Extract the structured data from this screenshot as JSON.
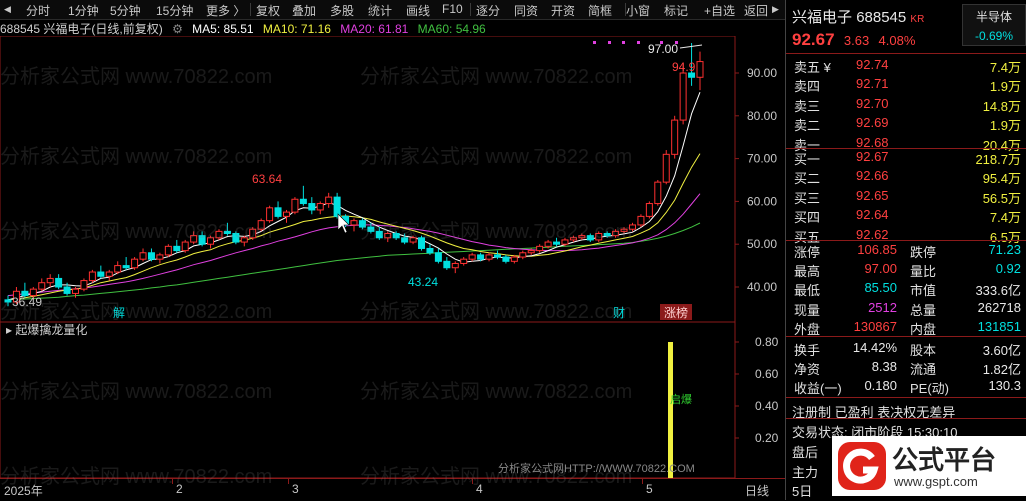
{
  "toolbar": {
    "items": [
      "分时",
      "1分钟",
      "5分钟",
      "15分钟",
      "更多 〉",
      "复权",
      "叠加",
      "多股",
      "统计",
      "画线",
      "F10",
      "逐分",
      "同资",
      "开资",
      "简框",
      "小窗",
      "标记",
      "+自选",
      "返回"
    ],
    "nav_prev": "◀",
    "nav_next": "▶"
  },
  "legend": {
    "stock": "688545 兴福电子(日线,前复权)",
    "ma5": "MA5: 85.51",
    "ma10": "MA10: 71.16",
    "ma20": "MA20: 61.81",
    "ma60": "MA60: 54.96",
    "ma_color_5": "#ffffff",
    "ma_color_10": "#f0f040",
    "ma_color_20": "#e040e0",
    "ma_color_60": "#40c040"
  },
  "main_chart": {
    "y_ticks": [
      "90.00",
      "80.00",
      "70.00",
      "60.00",
      "50.00",
      "40.00"
    ],
    "annotations": {
      "high_label": "63.64",
      "low_label": "43.24",
      "left_label": "36.49",
      "peak_label": "97.00",
      "near_peak_label": "94.9"
    },
    "markers": {
      "jie": "解",
      "cai": "财",
      "zhangbang": "涨榜"
    }
  },
  "indicator": {
    "title": "起爆擒龙量化",
    "y_ticks": [
      "0.80",
      "0.60",
      "0.40",
      "0.20"
    ],
    "signal_label": "启爆",
    "footer": "分析家公式网HTTP://WWW.70822.COM"
  },
  "x_axis": {
    "labels": [
      "2025年",
      "2",
      "3",
      "4",
      "5"
    ],
    "period": "日线"
  },
  "chart_data": {
    "type": "candlestick",
    "title": "688545 兴福电子(日线,前复权)",
    "y_range": [
      35,
      100
    ],
    "candles": [
      [
        37,
        38,
        35.5,
        36.5
      ],
      [
        36.5,
        40,
        36,
        39
      ],
      [
        39,
        41,
        37.5,
        38
      ],
      [
        38,
        40,
        37,
        39.5
      ],
      [
        39.5,
        42,
        39,
        41
      ],
      [
        41,
        43,
        40,
        42
      ],
      [
        42,
        43,
        39.5,
        40
      ],
      [
        40,
        41,
        38,
        38.5
      ],
      [
        38.5,
        40,
        37.5,
        39.5
      ],
      [
        39.5,
        42,
        39,
        41.5
      ],
      [
        41.5,
        44,
        41,
        43.5
      ],
      [
        43.5,
        45,
        42,
        42.5
      ],
      [
        42.5,
        44,
        41.5,
        43.5
      ],
      [
        43.5,
        46,
        43,
        45
      ],
      [
        45,
        47,
        44,
        44.5
      ],
      [
        44.5,
        47,
        44,
        46.5
      ],
      [
        46.5,
        49,
        46,
        48
      ],
      [
        48,
        49,
        46,
        46.5
      ],
      [
        46.5,
        48,
        45.5,
        47.5
      ],
      [
        47.5,
        50,
        47,
        49.5
      ],
      [
        49.5,
        51,
        48,
        48.5
      ],
      [
        48.5,
        51,
        48,
        50.5
      ],
      [
        50.5,
        53,
        50,
        52
      ],
      [
        52,
        53,
        49.5,
        50
      ],
      [
        50,
        52,
        49,
        51.5
      ],
      [
        51.5,
        53.5,
        51,
        53
      ],
      [
        53,
        55,
        52,
        52.5
      ],
      [
        52.5,
        53,
        50,
        50.5
      ],
      [
        50.5,
        52,
        49.5,
        51.5
      ],
      [
        51.5,
        54,
        51,
        53.5
      ],
      [
        53.5,
        56,
        53,
        55.5
      ],
      [
        55.5,
        59,
        55,
        58.5
      ],
      [
        58.5,
        60,
        56,
        56.5
      ],
      [
        56.5,
        58,
        55,
        57.5
      ],
      [
        57.5,
        61,
        57,
        60.5
      ],
      [
        60.5,
        63.64,
        59,
        59.5
      ],
      [
        59.5,
        61,
        57,
        58
      ],
      [
        58,
        60,
        57,
        59.5
      ],
      [
        59.5,
        62,
        58.5,
        61
      ],
      [
        61,
        62,
        56,
        56.5
      ],
      [
        56.5,
        57,
        54,
        54.5
      ],
      [
        54.5,
        56,
        53,
        55.5
      ],
      [
        55.5,
        56,
        53.5,
        54
      ],
      [
        54,
        55,
        52.5,
        53
      ],
      [
        53,
        54,
        51,
        51.5
      ],
      [
        51.5,
        53,
        50.5,
        52.5
      ],
      [
        52.5,
        53,
        51,
        51.5
      ],
      [
        51.5,
        52.5,
        50,
        50.5
      ],
      [
        50.5,
        52,
        50,
        51.5
      ],
      [
        51.5,
        52,
        48.5,
        49
      ],
      [
        49,
        50,
        47.5,
        48
      ],
      [
        48,
        49,
        45.5,
        46
      ],
      [
        46,
        47,
        44,
        44.5
      ],
      [
        44.5,
        46,
        43.24,
        45.5
      ],
      [
        45.5,
        47,
        45,
        46.5
      ],
      [
        46.5,
        48,
        46,
        47.5
      ],
      [
        47.5,
        48,
        46,
        46.5
      ],
      [
        46.5,
        48,
        46,
        47.5
      ],
      [
        47.5,
        48.5,
        46.5,
        47
      ],
      [
        47,
        47.5,
        45.5,
        46
      ],
      [
        46,
        47.5,
        45.5,
        47
      ],
      [
        47,
        48.5,
        46.5,
        48
      ],
      [
        48,
        49,
        47.5,
        48.5
      ],
      [
        48.5,
        50,
        48,
        49.5
      ],
      [
        49.5,
        51,
        49,
        50.5
      ],
      [
        50.5,
        51.5,
        49.5,
        50
      ],
      [
        50,
        51.5,
        49.5,
        51
      ],
      [
        51,
        52,
        50.5,
        51.5
      ],
      [
        51.5,
        52.5,
        51,
        52
      ],
      [
        52,
        52.5,
        50.5,
        51
      ],
      [
        51,
        53,
        50.5,
        52.5
      ],
      [
        52.5,
        53,
        51.5,
        52
      ],
      [
        52,
        53.5,
        51.5,
        53
      ],
      [
        53,
        54,
        52.5,
        53.5
      ],
      [
        53.5,
        55,
        53,
        54.5
      ],
      [
        54.5,
        57,
        54,
        56.5
      ],
      [
        56.5,
        60,
        56,
        59.5
      ],
      [
        59.5,
        65,
        59,
        64.5
      ],
      [
        64.5,
        72,
        64,
        71
      ],
      [
        71,
        80,
        70,
        79
      ],
      [
        79,
        92,
        78,
        90
      ],
      [
        90,
        97,
        87,
        89
      ],
      [
        89,
        95,
        86,
        92.67
      ]
    ],
    "ma5": [
      37,
      37.5,
      38,
      38.5,
      39,
      40,
      40.5,
      40.5,
      40.3,
      40.2,
      41,
      42,
      42.3,
      43.3,
      44,
      44.5,
      45.5,
      46.4,
      46.6,
      47.1,
      48,
      48.5,
      49.6,
      50,
      50.3,
      51,
      51.8,
      52,
      51.8,
      52.2,
      53,
      54.3,
      55.3,
      56.3,
      57.8,
      58.5,
      58.4,
      58.9,
      59.7,
      59.1,
      57.9,
      57,
      56.2,
      55,
      54,
      53.2,
      52.5,
      51.9,
      51.6,
      51,
      50.1,
      49.1,
      47.7,
      46.5,
      45.8,
      46,
      46.2,
      46.7,
      47,
      46.8,
      46.8,
      47.1,
      47.3,
      47.8,
      48.5,
      49.3,
      49.9,
      50.5,
      51,
      51.2,
      51.6,
      51.9,
      52.1,
      52.4,
      52.8,
      53.9,
      55.3,
      57.6,
      61.2,
      66,
      73,
      80.5,
      85.51
    ],
    "ma10": [
      37,
      37.2,
      37.5,
      37.8,
      38.2,
      38.6,
      39,
      39.3,
      39.5,
      39.8,
      40.4,
      41,
      41.4,
      41.8,
      42.2,
      42.9,
      43.7,
      44.5,
      45.2,
      45.8,
      46.3,
      47,
      47.8,
      48.3,
      48.7,
      49.5,
      50.1,
      50.6,
      50.9,
      51.4,
      52,
      52.8,
      53.4,
      54,
      54.6,
      55.3,
      55.6,
      56,
      56.3,
      56.5,
      56.6,
      56.4,
      56.2,
      55.8,
      55.2,
      54.7,
      54.2,
      53.7,
      53.2,
      52.6,
      51.9,
      51.1,
      50.3,
      49.6,
      49,
      48.7,
      48.3,
      48,
      47.8,
      47.5,
      47.3,
      47.2,
      47.2,
      47.4,
      47.6,
      48,
      48.4,
      48.9,
      49.4,
      49.8,
      50.2,
      50.6,
      51,
      51.4,
      51.8,
      52.6,
      53.5,
      55,
      57.4,
      60.3,
      64.2,
      68,
      71.16
    ],
    "ma20": [
      38,
      38.2,
      38.4,
      38.6,
      38.8,
      39,
      39.2,
      39.4,
      39.6,
      39.8,
      40,
      40.3,
      40.6,
      40.9,
      41.2,
      41.6,
      42,
      42.5,
      43,
      43.5,
      44,
      44.6,
      45.2,
      45.7,
      46.2,
      46.8,
      47.4,
      48,
      48.5,
      49,
      49.6,
      50.1,
      50.7,
      51.2,
      51.7,
      52.3,
      52.9,
      53.4,
      53.8,
      54.1,
      54.3,
      54.4,
      54.5,
      54.5,
      54.4,
      54.3,
      54.1,
      53.9,
      53.6,
      53.3,
      53,
      52.6,
      52.1,
      51.6,
      51.1,
      50.6,
      50.2,
      49.8,
      49.5,
      49.2,
      49,
      48.8,
      48.7,
      48.6,
      48.5,
      48.5,
      48.5,
      48.6,
      48.7,
      48.9,
      49.1,
      49.4,
      49.7,
      50,
      50.3,
      50.8,
      51.4,
      52.2,
      53.4,
      55,
      57,
      59.4,
      61.81
    ],
    "ma60": [
      37,
      37.1,
      37.2,
      37.3,
      37.4,
      37.5,
      37.6,
      37.8,
      38,
      38.1,
      38.3,
      38.5,
      38.7,
      38.9,
      39.1,
      39.3,
      39.5,
      39.8,
      40,
      40.3,
      40.5,
      40.8,
      41.1,
      41.4,
      41.7,
      42,
      42.3,
      42.6,
      42.9,
      43.2,
      43.5,
      43.8,
      44.1,
      44.4,
      44.7,
      45,
      45.3,
      45.6,
      45.9,
      46.2,
      46.4,
      46.6,
      46.8,
      47,
      47.2,
      47.4,
      47.5,
      47.6,
      47.7,
      47.8,
      47.9,
      48,
      48.1,
      48.2,
      48.3,
      48.4,
      48.5,
      48.6,
      48.7,
      48.8,
      48.9,
      49,
      49.1,
      49.2,
      49.3,
      49.4,
      49.5,
      49.6,
      49.7,
      49.8,
      49.9,
      50,
      50.1,
      50.2,
      50.4,
      50.7,
      51,
      51.4,
      51.9,
      52.5,
      53.2,
      54,
      54.96
    ]
  },
  "panel": {
    "name": "兴福电子",
    "code": "688545",
    "tag": "KR",
    "sector": "半导体",
    "sector_change": "-0.69%",
    "price": "92.67",
    "change": "3.63",
    "change_pct": "4.08%",
    "sell": [
      {
        "label": "卖五 ¥",
        "price": "92.74",
        "vol": "7.4万"
      },
      {
        "label": "卖四",
        "price": "92.71",
        "vol": "1.9万"
      },
      {
        "label": "卖三",
        "price": "92.70",
        "vol": "14.8万"
      },
      {
        "label": "卖二",
        "price": "92.69",
        "vol": "1.9万"
      },
      {
        "label": "卖一",
        "price": "92.68",
        "vol": "20.4万"
      }
    ],
    "buy": [
      {
        "label": "买一",
        "price": "92.67",
        "vol": "218.7万"
      },
      {
        "label": "买二",
        "price": "92.66",
        "vol": "95.4万"
      },
      {
        "label": "买三",
        "price": "92.65",
        "vol": "56.5万"
      },
      {
        "label": "买四",
        "price": "92.64",
        "vol": "7.4万"
      },
      {
        "label": "买五",
        "price": "92.62",
        "vol": "6.5万"
      }
    ],
    "stats": [
      {
        "l1": "涨停",
        "v1": "106.85",
        "c1": "red",
        "l2": "跌停",
        "v2": "71.23",
        "c2": "green"
      },
      {
        "l1": "最高",
        "v1": "97.00",
        "c1": "red",
        "l2": "量比",
        "v2": "0.92",
        "c2": "green"
      },
      {
        "l1": "最低",
        "v1": "85.50",
        "c1": "green",
        "l2": "市值",
        "v2": "333.6亿",
        "c2": "white"
      },
      {
        "l1": "现量",
        "v1": "2512",
        "c1": "mag",
        "l2": "总量",
        "v2": "262718",
        "c2": "white"
      },
      {
        "l1": "外盘",
        "v1": "130867",
        "c1": "red",
        "l2": "内盘",
        "v2": "131851",
        "c2": "green"
      }
    ],
    "stats2": [
      {
        "l1": "换手",
        "v1": "14.42%",
        "l2": "股本",
        "v2": "3.60亿"
      },
      {
        "l1": "净资",
        "v1": "8.38",
        "l2": "流通",
        "v2": "1.82亿"
      },
      {
        "l1": "收益(一)",
        "v1": "0.180",
        "l2": "PE(动)",
        "v2": "130.3"
      }
    ],
    "info1": "注册制 已盈利 表决权无差异",
    "info2": "交易状态: 闭市阶段 15:30:10",
    "info3": "盘后",
    "info4": "主力",
    "info5": "5日",
    "logo_text": "公式平台",
    "logo_url": "www.gspt.com"
  },
  "watermark": "分析家公式网 www.70822.com"
}
